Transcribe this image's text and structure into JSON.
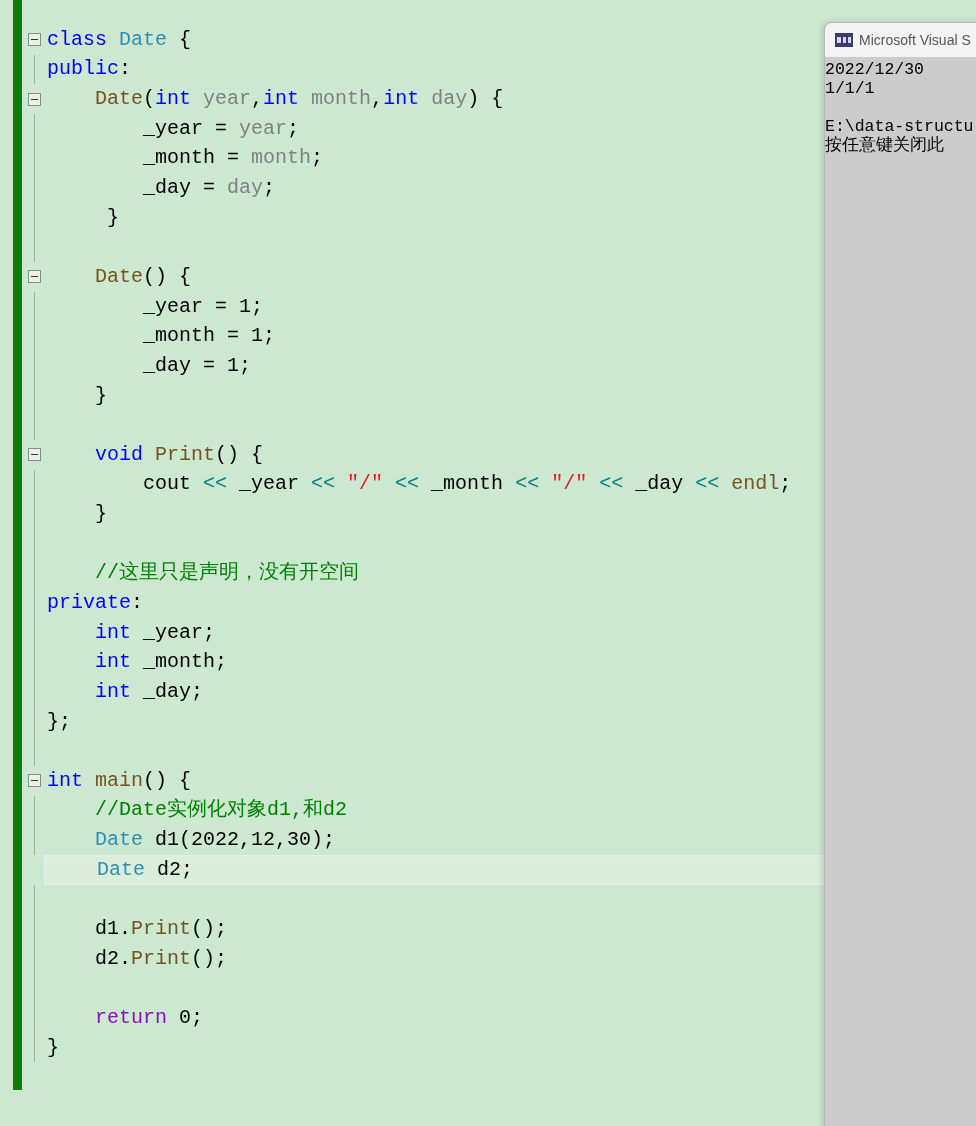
{
  "editor": {
    "lines": [
      {
        "fold": true,
        "current": false,
        "tokens": [
          {
            "kind": "kw",
            "t": "class "
          },
          {
            "kind": "type",
            "t": "Date"
          },
          {
            "kind": "plain",
            "t": " {"
          }
        ]
      },
      {
        "fold": false,
        "current": false,
        "tokens": [
          {
            "kind": "kw",
            "t": "public"
          },
          {
            "kind": "plain",
            "t": ":"
          }
        ]
      },
      {
        "fold": true,
        "current": false,
        "tokens": [
          {
            "kind": "func",
            "t": "    Date"
          },
          {
            "kind": "plain",
            "t": "("
          },
          {
            "kind": "kw",
            "t": "int "
          },
          {
            "kind": "param",
            "t": "year"
          },
          {
            "kind": "plain",
            "t": ","
          },
          {
            "kind": "kw",
            "t": "int "
          },
          {
            "kind": "param",
            "t": "month"
          },
          {
            "kind": "plain",
            "t": ","
          },
          {
            "kind": "kw",
            "t": "int "
          },
          {
            "kind": "param",
            "t": "day"
          },
          {
            "kind": "plain",
            "t": ") {"
          }
        ]
      },
      {
        "fold": false,
        "current": false,
        "tokens": [
          {
            "kind": "plain",
            "t": "        _year = "
          },
          {
            "kind": "param",
            "t": "year"
          },
          {
            "kind": "plain",
            "t": ";"
          }
        ]
      },
      {
        "fold": false,
        "current": false,
        "tokens": [
          {
            "kind": "plain",
            "t": "        _month = "
          },
          {
            "kind": "param",
            "t": "month"
          },
          {
            "kind": "plain",
            "t": ";"
          }
        ]
      },
      {
        "fold": false,
        "current": false,
        "tokens": [
          {
            "kind": "plain",
            "t": "        _day = "
          },
          {
            "kind": "param",
            "t": "day"
          },
          {
            "kind": "plain",
            "t": ";"
          }
        ]
      },
      {
        "fold": false,
        "current": false,
        "tokens": [
          {
            "kind": "plain",
            "t": "     }"
          }
        ]
      },
      {
        "fold": false,
        "current": false
      },
      {
        "fold": true,
        "current": false,
        "tokens": [
          {
            "kind": "func",
            "t": "    Date"
          },
          {
            "kind": "plain",
            "t": "() {"
          }
        ]
      },
      {
        "fold": false,
        "current": false,
        "tokens": [
          {
            "kind": "plain",
            "t": "        _year = 1;"
          }
        ]
      },
      {
        "fold": false,
        "current": false,
        "tokens": [
          {
            "kind": "plain",
            "t": "        _month = 1;"
          }
        ]
      },
      {
        "fold": false,
        "current": false,
        "tokens": [
          {
            "kind": "plain",
            "t": "        _day = 1;"
          }
        ]
      },
      {
        "fold": false,
        "current": false,
        "tokens": [
          {
            "kind": "plain",
            "t": "    }"
          }
        ]
      },
      {
        "fold": false,
        "current": false
      },
      {
        "fold": true,
        "current": false,
        "tokens": [
          {
            "kind": "kw",
            "t": "    void "
          },
          {
            "kind": "func",
            "t": "Print"
          },
          {
            "kind": "plain",
            "t": "() {"
          }
        ]
      },
      {
        "fold": false,
        "current": false,
        "tokens": [
          {
            "kind": "plain",
            "t": "        cout "
          },
          {
            "kind": "op",
            "t": "<<"
          },
          {
            "kind": "plain",
            "t": " _year "
          },
          {
            "kind": "op",
            "t": "<< "
          },
          {
            "kind": "str",
            "t": "\"/\""
          },
          {
            "kind": "op",
            "t": " <<"
          },
          {
            "kind": "plain",
            "t": " _month "
          },
          {
            "kind": "op",
            "t": "<< "
          },
          {
            "kind": "str",
            "t": "\"/\""
          },
          {
            "kind": "op",
            "t": " <<"
          },
          {
            "kind": "plain",
            "t": " _day "
          },
          {
            "kind": "op",
            "t": "<< "
          },
          {
            "kind": "func",
            "t": "endl"
          },
          {
            "kind": "plain",
            "t": ";"
          }
        ]
      },
      {
        "fold": false,
        "current": false,
        "tokens": [
          {
            "kind": "plain",
            "t": "    }"
          }
        ]
      },
      {
        "fold": false,
        "current": false
      },
      {
        "fold": false,
        "current": false,
        "tokens": [
          {
            "kind": "comment",
            "t": "    //这里只是声明，没有开空间"
          }
        ]
      },
      {
        "fold": false,
        "current": false,
        "tokens": [
          {
            "kind": "kw",
            "t": "private"
          },
          {
            "kind": "plain",
            "t": ":"
          }
        ]
      },
      {
        "fold": false,
        "current": false,
        "tokens": [
          {
            "kind": "kw",
            "t": "    int "
          },
          {
            "kind": "plain",
            "t": "_year;"
          }
        ]
      },
      {
        "fold": false,
        "current": false,
        "tokens": [
          {
            "kind": "kw",
            "t": "    int "
          },
          {
            "kind": "plain",
            "t": "_month;"
          }
        ]
      },
      {
        "fold": false,
        "current": false,
        "tokens": [
          {
            "kind": "kw",
            "t": "    int "
          },
          {
            "kind": "plain",
            "t": "_day;"
          }
        ]
      },
      {
        "fold": false,
        "current": false,
        "tokens": [
          {
            "kind": "plain",
            "t": "};"
          }
        ]
      },
      {
        "fold": false,
        "current": false
      },
      {
        "fold": true,
        "current": false,
        "tokens": [
          {
            "kind": "kw",
            "t": "int "
          },
          {
            "kind": "func",
            "t": "main"
          },
          {
            "kind": "plain",
            "t": "() {"
          }
        ]
      },
      {
        "fold": false,
        "current": false,
        "tokens": [
          {
            "kind": "comment",
            "t": "    //Date实例化对象d1,和d2"
          }
        ]
      },
      {
        "fold": false,
        "current": false,
        "tokens": [
          {
            "kind": "type",
            "t": "    Date "
          },
          {
            "kind": "plain",
            "t": "d1(2022,12,30);"
          }
        ]
      },
      {
        "fold": false,
        "current": true,
        "tokens": [
          {
            "kind": "type",
            "t": "    Date "
          },
          {
            "kind": "plain",
            "t": "d2;"
          }
        ]
      },
      {
        "fold": false,
        "current": false
      },
      {
        "fold": false,
        "current": false,
        "tokens": [
          {
            "kind": "plain",
            "t": "    d1."
          },
          {
            "kind": "func",
            "t": "Print"
          },
          {
            "kind": "plain",
            "t": "();"
          }
        ]
      },
      {
        "fold": false,
        "current": false,
        "tokens": [
          {
            "kind": "plain",
            "t": "    d2."
          },
          {
            "kind": "func",
            "t": "Print"
          },
          {
            "kind": "plain",
            "t": "();"
          }
        ]
      },
      {
        "fold": false,
        "current": false
      },
      {
        "fold": false,
        "current": false,
        "tokens": [
          {
            "kind": "ret",
            "t": "    return "
          },
          {
            "kind": "plain",
            "t": "0;"
          }
        ]
      },
      {
        "fold": false,
        "current": false,
        "tokens": [
          {
            "kind": "plain",
            "t": "}"
          }
        ]
      }
    ]
  },
  "console": {
    "title": "Microsoft Visual S",
    "output": [
      "2022/12/30",
      "1/1/1"
    ],
    "messages": [
      "E:\\data-structu",
      "按任意键关闭此"
    ]
  }
}
